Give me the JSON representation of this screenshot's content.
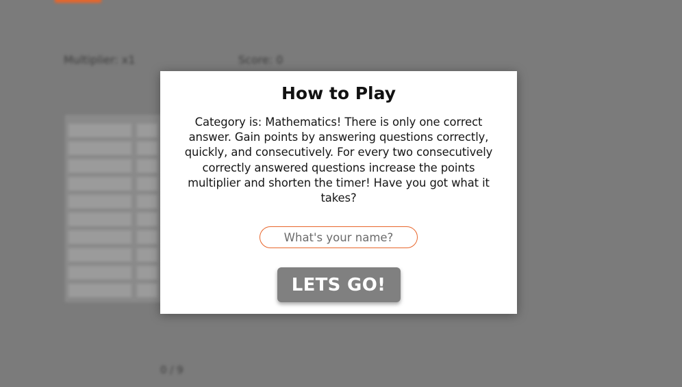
{
  "background": {
    "multiplier_label": "Multiplier: x1",
    "score_label": "Score: 0",
    "progress_label": "0 / 9",
    "accent_color": "#e8652a"
  },
  "modal": {
    "title": "How to Play",
    "body": "Category is: Mathematics! There is only one correct answer. Gain points by answering questions correctly, quickly, and consecutively. For every two consecutively correctly answered questions increase the points multiplier and shorten the timer! Have you got what it takes?",
    "name_input": {
      "placeholder": "What's your name?",
      "value": ""
    },
    "start_button_label": "LETS GO!"
  }
}
